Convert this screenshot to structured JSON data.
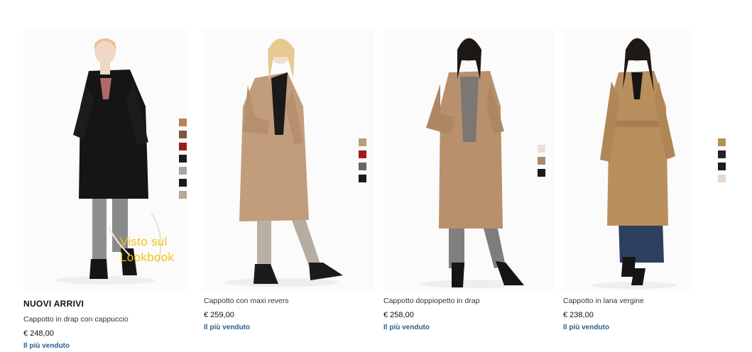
{
  "products": [
    {
      "new_label": "NUOVI ARRIVI",
      "title": "Cappotto in drap con cappuccio",
      "price": "€ 248,00",
      "tag": "Il più venduto",
      "badge_line1": "Visto sul",
      "badge_line2": "Lookbook",
      "coat_color": "#151515",
      "swatches": [
        "#b8825a",
        "#7a5840",
        "#9c1a1e",
        "#1c1c1c",
        "#a7a7a7",
        "#1a1a1a",
        "#b5a897"
      ]
    },
    {
      "title": "Cappotto con maxi revers",
      "price": "€ 259,00",
      "tag": "Il più venduto",
      "coat_color": "#c29d7c",
      "swatches": [
        "#b99c7e",
        "#a6191c",
        "#666666",
        "#1a1a1a"
      ]
    },
    {
      "title": "Cappotto doppiopetto in drap",
      "price": "€ 258,00",
      "tag": "Il più venduto",
      "coat_color": "#b8906c",
      "swatches": [
        "#ece0d6",
        "#b08a68",
        "#1a1a1a"
      ]
    },
    {
      "title": "Cappotto in lana vergine",
      "price": "€ 238,00",
      "tag": "Il più venduto",
      "coat_color": "#b98f5d",
      "swatches": [
        "#b88c5e",
        "#222226",
        "#221a1c",
        "#e6d7cc"
      ]
    }
  ]
}
